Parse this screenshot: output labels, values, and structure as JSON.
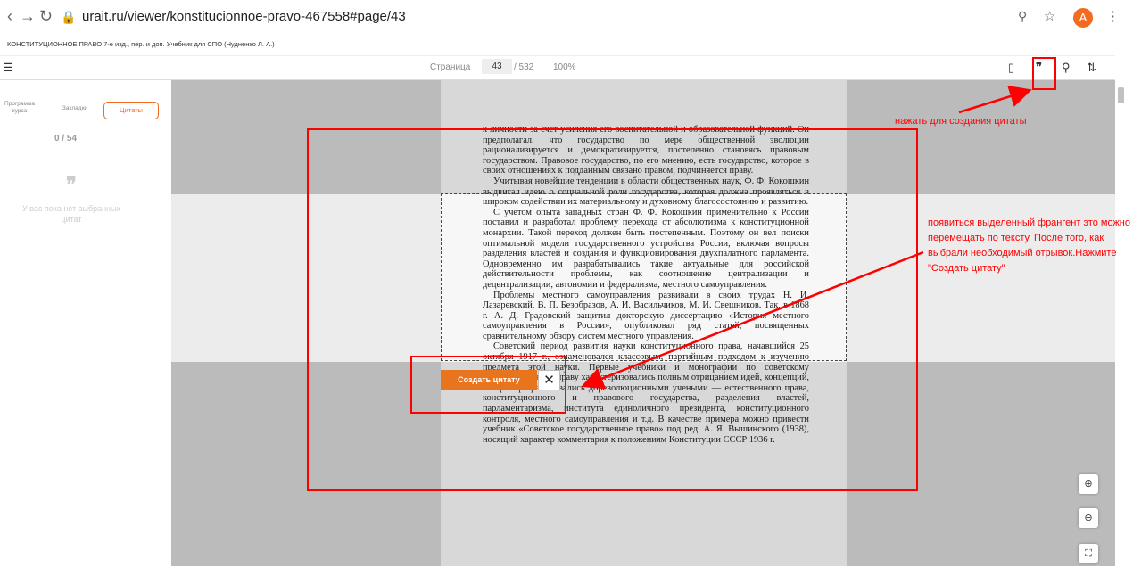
{
  "browser": {
    "url": "urait.ru/viewer/konstitucionnoe-pravo-467558#page/43",
    "avatar_letter": "A"
  },
  "book": {
    "title": "КОНСТИТУЦИОННОЕ ПРАВО 7-е изд., пер. и доп. Учебник для СПО (Нудненко Л. А.)"
  },
  "toolbar": {
    "page_label": "Страница",
    "page_number": "43",
    "page_total": "/ 532",
    "zoom": "100%"
  },
  "sidebar": {
    "tabs": [
      "Программа курса",
      "Закладки",
      "Цитаты"
    ],
    "count": "0 / 54",
    "quote_glyph": "❞",
    "empty_text": "У вас пока нет выбранных цитат"
  },
  "page": {
    "paragraphs": [
      "к личности за счет усиления его воспитательной и образовательной функций. Он предполагал, что государство по мере общественной эволюции рационализируется и демократизируется, постепенно становясь правовым государством. Правовое государство, по его мнению, есть государство, которое в своих отношениях к подданным связано правом, подчиняется праву.",
      "Учитывая новейшие тенденции в области общественных наук, Ф. Ф. Кокошкин выдвигал идею о социальной роли государства, которая должна проявляться в широком содействии их материальному и духовному благосостоянию и развитию.",
      "С учетом опыта западных стран Ф. Ф. Кокошкин применительно к России поставил и разработал проблему перехода от абсолютизма к конституционной монархии. Такой переход должен быть постепенным. Поэтому он вел поиски оптимальной модели государственного устройства России, включая вопросы разделения властей и создания и функционирования двухпалатного парламента. Одновременно им разрабатывались такие актуальные для российской действительности проблемы, как соотношение централизации и децентрализации, автономии и федерализма, местного самоуправления.",
      "Проблемы местного самоуправления развивали в своих трудах Н. И. Лазаревский, В. П. Безобразов, А. И. Васильчиков, М. И. Свешников. Так, в 1868 г. А. Д. Градовский защитил докторскую диссертацию «История местного самоуправления в России», опубликовал ряд статей, посвященных сравнительному обзору систем местного управления.",
      "Советский период развития науки конституционного права, начавшийся 25 октября 1917 г., ознаменовался классовым, партийным подходом к изучению предмета этой науки. Первые учебники и монографии по советскому государственному праву характеризовались полным отрицанием идей, концепций, которые разрабатывались дореволюционными учеными — естественного права, конституционного и правового государства, разделения властей, парламентаризма, института единоличного президента, конституционного контроля, местного самоуправления и т.д. В качестве примера можно привести учебник «Советское государственное право» под ред. А. Я. Вышинского (1938), носящий характер комментария к положениям Конституции СССР 1936 г."
    ]
  },
  "quote_controls": {
    "create_label": "Создать цитату",
    "close_symbol": "✕"
  },
  "annotations": {
    "note_top": "нажать для создания цитаты",
    "note_right": "появиться выделенный франгент это можно перемещать по тексту. После того, как выбрали необходимый отрывок.Нажмите \"Создать цитату\"",
    "color": "#ff0000"
  },
  "icons": {
    "back": "arrow-left-icon",
    "forward": "arrow-right-icon",
    "reload": "reload-icon",
    "lock": "lock-icon",
    "search": "search-icon",
    "star": "star-icon",
    "menu": "menu-icon",
    "bookmark": "bookmark-icon",
    "quote": "quote-icon",
    "adjust": "adjust-icon",
    "zoom_in": "zoom-in-icon",
    "zoom_out": "zoom-out-icon",
    "fullscreen": "fullscreen-icon"
  }
}
